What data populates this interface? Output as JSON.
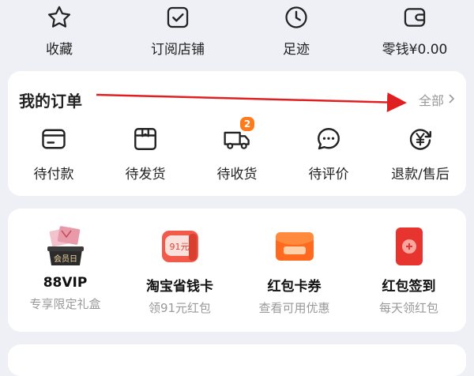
{
  "quick_links": [
    {
      "label": "收藏",
      "icon": "star-icon"
    },
    {
      "label": "订阅店铺",
      "icon": "checkbox-icon"
    },
    {
      "label": "足迹",
      "icon": "clock-icon"
    },
    {
      "label": "零钱¥0.00",
      "icon": "wallet-icon"
    }
  ],
  "orders": {
    "title": "我的订单",
    "all_label": "全部",
    "items": [
      {
        "label": "待付款",
        "icon": "card-icon"
      },
      {
        "label": "待发货",
        "icon": "package-icon"
      },
      {
        "label": "待收货",
        "icon": "truck-icon",
        "badge": "2"
      },
      {
        "label": "待评价",
        "icon": "chat-bubble-icon"
      },
      {
        "label": "退款/售后",
        "icon": "yen-refund-icon"
      }
    ]
  },
  "services": [
    {
      "title": "88VIP",
      "subtitle": "专享限定礼盒",
      "icon_text": "会员日",
      "icon": "vip-giftbox-icon"
    },
    {
      "title": "淘宝省钱卡",
      "subtitle": "领91元红包",
      "icon_text": "91元",
      "icon": "savings-card-icon"
    },
    {
      "title": "红包卡券",
      "subtitle": "查看可用优惠",
      "icon": "red-envelope-icon"
    },
    {
      "title": "红包签到",
      "subtitle": "每天领红包",
      "icon": "signin-envelope-icon"
    }
  ],
  "colors": {
    "accent": "#ff7a1a",
    "arrow": "#e02020",
    "muted": "#999999"
  }
}
